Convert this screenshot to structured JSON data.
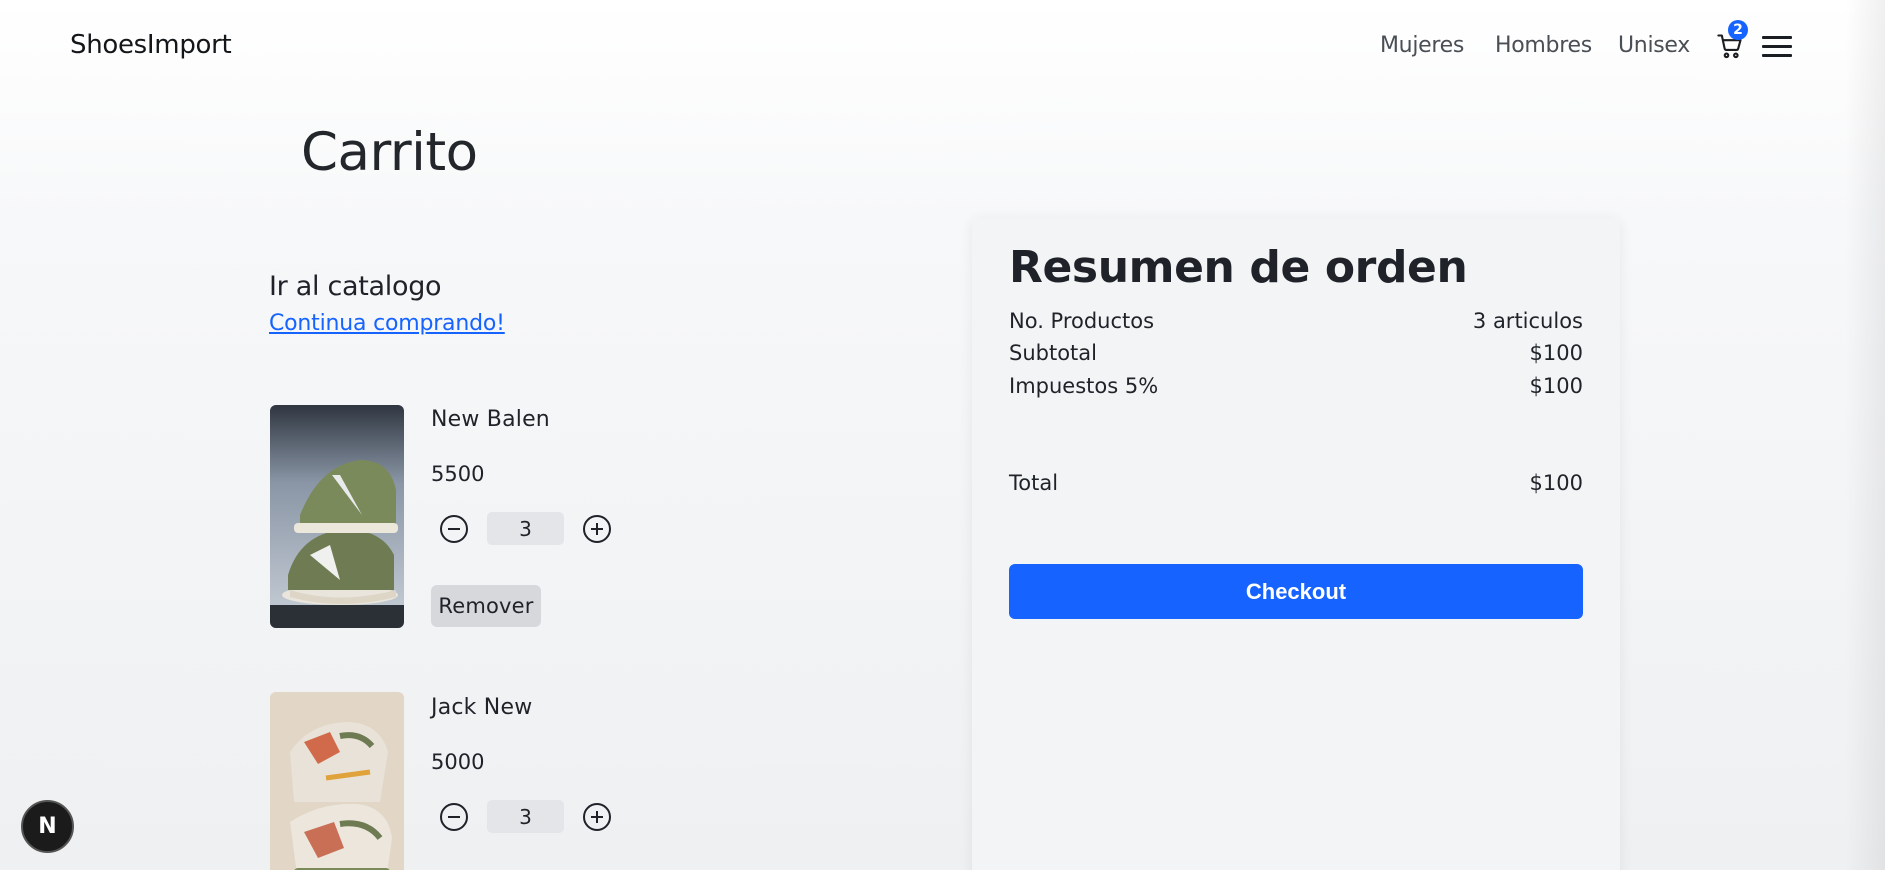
{
  "header": {
    "brand": "ShoesImport",
    "menu": [
      "Mujeres",
      "Hombres",
      "Unisex"
    ],
    "cart_count": "2",
    "cart_icon": "cart-icon",
    "menu_icon": "hamburger-icon"
  },
  "page": {
    "title": "Carrito"
  },
  "catalog": {
    "title": "Ir al catalogo",
    "link": "Continua comprando!"
  },
  "cart_items": [
    {
      "name": "New Balen",
      "price": "5500",
      "quantity": "3",
      "remove_label": "Remover"
    },
    {
      "name": "Jack New",
      "price": "5000",
      "quantity": "3"
    }
  ],
  "summary": {
    "title": "Resumen de orden",
    "rows": [
      {
        "label": "No. Productos",
        "value": "3 articulos"
      },
      {
        "label": "Subtotal",
        "value": "$100"
      },
      {
        "label": "Impuestos 5%",
        "value": "$100"
      }
    ],
    "total_label": "Total",
    "total_value": "$100",
    "checkout_label": "Checkout"
  },
  "dev_badge": "N",
  "colors": {
    "accent": "#1663ff",
    "text": "#1f2329",
    "qty_bg": "#e3e5e8",
    "remove_bg": "#d6d8dc"
  }
}
